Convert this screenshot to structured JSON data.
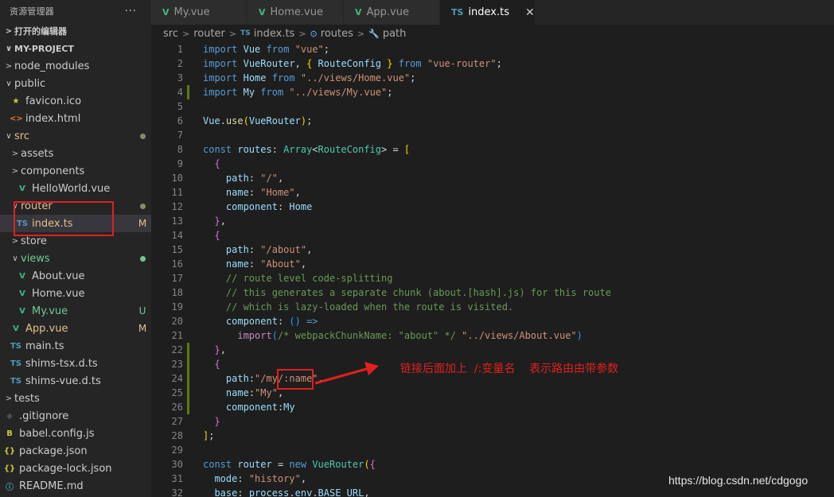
{
  "sidebar": {
    "title": "资源管理器",
    "more": "···",
    "open_editors": "打开的编辑器",
    "project": "MY-PROJECT",
    "items": [
      {
        "label": "node_modules",
        "depth": 1,
        "chevron": ">",
        "icon": "",
        "icon_class": "",
        "badge": "",
        "label_class": "",
        "badge_class": ""
      },
      {
        "label": "public",
        "depth": 1,
        "chevron": "∨",
        "icon": "",
        "icon_class": "",
        "badge": "",
        "label_class": "",
        "badge_class": ""
      },
      {
        "label": "favicon.ico",
        "depth": 2,
        "chevron": "",
        "icon": "★",
        "icon_class": "c-star",
        "badge": "",
        "label_class": "",
        "badge_class": ""
      },
      {
        "label": "index.html",
        "depth": 2,
        "chevron": "",
        "icon": "<>",
        "icon_class": "c-html",
        "badge": "",
        "label_class": "",
        "badge_class": ""
      },
      {
        "label": "src",
        "depth": 1,
        "chevron": "∨",
        "icon": "",
        "icon_class": "",
        "badge": "dot",
        "label_class": "lbl-yellow",
        "badge_class": "lbl-yellow"
      },
      {
        "label": "assets",
        "depth": 2,
        "chevron": ">",
        "icon": "",
        "icon_class": "",
        "badge": "",
        "label_class": "",
        "badge_class": ""
      },
      {
        "label": "components",
        "depth": 2,
        "chevron": ">",
        "icon": "",
        "icon_class": "",
        "badge": "",
        "label_class": "",
        "badge_class": ""
      },
      {
        "label": "HelloWorld.vue",
        "depth": 3,
        "chevron": "",
        "icon": "V",
        "icon_class": "c-vue",
        "badge": "",
        "label_class": "",
        "badge_class": ""
      },
      {
        "label": "router",
        "depth": 2,
        "chevron": "∨",
        "icon": "",
        "icon_class": "",
        "badge": "dot",
        "label_class": "lbl-yellow",
        "badge_class": "lbl-yellow"
      },
      {
        "label": "index.ts",
        "depth": 3,
        "chevron": "",
        "icon": "TS",
        "icon_class": "c-ts",
        "badge": "M",
        "label_class": "lbl-yellow",
        "badge_class": "lbl-yellow",
        "selected": true
      },
      {
        "label": "store",
        "depth": 2,
        "chevron": ">",
        "icon": "",
        "icon_class": "",
        "badge": "",
        "label_class": "",
        "badge_class": ""
      },
      {
        "label": "views",
        "depth": 2,
        "chevron": "∨",
        "icon": "",
        "icon_class": "",
        "badge": "dot",
        "label_class": "lbl-green",
        "badge_class": "lbl-green"
      },
      {
        "label": "About.vue",
        "depth": 3,
        "chevron": "",
        "icon": "V",
        "icon_class": "c-vue",
        "badge": "",
        "label_class": "",
        "badge_class": ""
      },
      {
        "label": "Home.vue",
        "depth": 3,
        "chevron": "",
        "icon": "V",
        "icon_class": "c-vue",
        "badge": "",
        "label_class": "",
        "badge_class": ""
      },
      {
        "label": "My.vue",
        "depth": 3,
        "chevron": "",
        "icon": "V",
        "icon_class": "c-vue",
        "badge": "U",
        "label_class": "lbl-green",
        "badge_class": "lbl-green"
      },
      {
        "label": "App.vue",
        "depth": 2,
        "chevron": "",
        "icon": "V",
        "icon_class": "c-vue",
        "badge": "M",
        "label_class": "lbl-yellow",
        "badge_class": "lbl-yellow"
      },
      {
        "label": "main.ts",
        "depth": 2,
        "chevron": "",
        "icon": "TS",
        "icon_class": "c-ts",
        "badge": "",
        "label_class": "",
        "badge_class": ""
      },
      {
        "label": "shims-tsx.d.ts",
        "depth": 2,
        "chevron": "",
        "icon": "TS",
        "icon_class": "c-ts",
        "badge": "",
        "label_class": "",
        "badge_class": ""
      },
      {
        "label": "shims-vue.d.ts",
        "depth": 2,
        "chevron": "",
        "icon": "TS",
        "icon_class": "c-ts",
        "badge": "",
        "label_class": "",
        "badge_class": ""
      },
      {
        "label": "tests",
        "depth": 1,
        "chevron": ">",
        "icon": "",
        "icon_class": "",
        "badge": "",
        "label_class": "",
        "badge_class": ""
      },
      {
        "label": ".gitignore",
        "depth": 1,
        "chevron": "",
        "icon": "◆",
        "icon_class": "c-git",
        "badge": "",
        "label_class": "",
        "badge_class": ""
      },
      {
        "label": "babel.config.js",
        "depth": 1,
        "chevron": "",
        "icon": "B",
        "icon_class": "c-babel",
        "badge": "",
        "label_class": "",
        "badge_class": ""
      },
      {
        "label": "package.json",
        "depth": 1,
        "chevron": "",
        "icon": "{}",
        "icon_class": "c-json",
        "badge": "",
        "label_class": "",
        "badge_class": ""
      },
      {
        "label": "package-lock.json",
        "depth": 1,
        "chevron": "",
        "icon": "{}",
        "icon_class": "c-json",
        "badge": "",
        "label_class": "",
        "badge_class": ""
      },
      {
        "label": "README.md",
        "depth": 1,
        "chevron": "",
        "icon": "ⓘ",
        "icon_class": "c-md",
        "badge": "",
        "label_class": "",
        "badge_class": ""
      }
    ]
  },
  "tabs": [
    {
      "label": "My.vue",
      "icon": "V",
      "icon_class": "c-vue",
      "active": false
    },
    {
      "label": "Home.vue",
      "icon": "V",
      "icon_class": "c-vue",
      "active": false
    },
    {
      "label": "App.vue",
      "icon": "V",
      "icon_class": "c-vue",
      "active": false
    },
    {
      "label": "index.ts",
      "icon": "TS",
      "icon_class": "c-ts",
      "active": true
    }
  ],
  "tab_close": "✕",
  "breadcrumb": {
    "parts": [
      "src",
      "router",
      "index.ts",
      "routes",
      "path"
    ],
    "icons": [
      "",
      "",
      "TS",
      "⊙",
      "🔧"
    ]
  },
  "editor": {
    "lines": [
      [
        [
          "kw",
          "import"
        ],
        [
          "pl",
          " "
        ],
        [
          "prop",
          "Vue"
        ],
        [
          "pl",
          " "
        ],
        [
          "kw",
          "from"
        ],
        [
          "pl",
          " "
        ],
        [
          "str",
          "\"vue\""
        ],
        [
          "pl",
          ";"
        ]
      ],
      [
        [
          "kw",
          "import"
        ],
        [
          "pl",
          " "
        ],
        [
          "prop",
          "VueRouter"
        ],
        [
          "pl",
          ", "
        ],
        [
          "br1",
          "{"
        ],
        [
          "pl",
          " "
        ],
        [
          "prop",
          "RouteConfig"
        ],
        [
          "pl",
          " "
        ],
        [
          "br1",
          "}"
        ],
        [
          "pl",
          " "
        ],
        [
          "kw",
          "from"
        ],
        [
          "pl",
          " "
        ],
        [
          "str",
          "\"vue-router\""
        ],
        [
          "pl",
          ";"
        ]
      ],
      [
        [
          "kw",
          "import"
        ],
        [
          "pl",
          " "
        ],
        [
          "prop",
          "Home"
        ],
        [
          "pl",
          " "
        ],
        [
          "kw",
          "from"
        ],
        [
          "pl",
          " "
        ],
        [
          "str",
          "\"../views/Home.vue\""
        ],
        [
          "pl",
          ";"
        ]
      ],
      [
        [
          "kw",
          "import"
        ],
        [
          "pl",
          " "
        ],
        [
          "prop",
          "My"
        ],
        [
          "pl",
          " "
        ],
        [
          "kw",
          "from"
        ],
        [
          "pl",
          " "
        ],
        [
          "str",
          "\"../views/My.vue\""
        ],
        [
          "pl",
          ";"
        ]
      ],
      [],
      [
        [
          "prop",
          "Vue"
        ],
        [
          "pl",
          "."
        ],
        [
          "fn",
          "use"
        ],
        [
          "br1",
          "("
        ],
        [
          "prop",
          "VueRouter"
        ],
        [
          "br1",
          ")"
        ],
        [
          "pl",
          ";"
        ]
      ],
      [],
      [
        [
          "kw",
          "const"
        ],
        [
          "pl",
          " "
        ],
        [
          "prop",
          "routes"
        ],
        [
          "pl",
          ": "
        ],
        [
          "ty",
          "Array"
        ],
        [
          "pl",
          "<"
        ],
        [
          "ty",
          "RouteConfig"
        ],
        [
          "pl",
          "> = "
        ],
        [
          "br1",
          "["
        ]
      ],
      [
        [
          "pl",
          "  "
        ],
        [
          "br2",
          "{"
        ]
      ],
      [
        [
          "pl",
          "    "
        ],
        [
          "prop",
          "path"
        ],
        [
          "pl",
          ": "
        ],
        [
          "str",
          "\"/\""
        ],
        [
          "pl",
          ","
        ]
      ],
      [
        [
          "pl",
          "    "
        ],
        [
          "prop",
          "name"
        ],
        [
          "pl",
          ": "
        ],
        [
          "str",
          "\"Home\""
        ],
        [
          "pl",
          ","
        ]
      ],
      [
        [
          "pl",
          "    "
        ],
        [
          "prop",
          "component"
        ],
        [
          "pl",
          ": "
        ],
        [
          "prop",
          "Home"
        ]
      ],
      [
        [
          "pl",
          "  "
        ],
        [
          "br2",
          "}"
        ],
        [
          "pl",
          ","
        ]
      ],
      [
        [
          "pl",
          "  "
        ],
        [
          "br2",
          "{"
        ]
      ],
      [
        [
          "pl",
          "    "
        ],
        [
          "prop",
          "path"
        ],
        [
          "pl",
          ": "
        ],
        [
          "str",
          "\"/about\""
        ],
        [
          "pl",
          ","
        ]
      ],
      [
        [
          "pl",
          "    "
        ],
        [
          "prop",
          "name"
        ],
        [
          "pl",
          ": "
        ],
        [
          "str",
          "\"About\""
        ],
        [
          "pl",
          ","
        ]
      ],
      [
        [
          "pl",
          "    "
        ],
        [
          "cm",
          "// route level code-splitting"
        ]
      ],
      [
        [
          "pl",
          "    "
        ],
        [
          "cm",
          "// this generates a separate chunk (about.[hash].js) for this route"
        ]
      ],
      [
        [
          "pl",
          "    "
        ],
        [
          "cm",
          "// which is lazy-loaded when the route is visited."
        ]
      ],
      [
        [
          "pl",
          "    "
        ],
        [
          "prop",
          "component"
        ],
        [
          "pl",
          ": "
        ],
        [
          "br3",
          "()"
        ],
        [
          "pl",
          " "
        ],
        [
          "kw",
          "=>"
        ]
      ],
      [
        [
          "pl",
          "      "
        ],
        [
          "kw2",
          "import"
        ],
        [
          "br3",
          "("
        ],
        [
          "cm",
          "/* webpackChunkName: \"about\" */"
        ],
        [
          "pl",
          " "
        ],
        [
          "str",
          "\"../views/About.vue\""
        ],
        [
          "br3",
          ")"
        ]
      ],
      [
        [
          "pl",
          "  "
        ],
        [
          "br2",
          "}"
        ],
        [
          "pl",
          ","
        ]
      ],
      [
        [
          "pl",
          "  "
        ],
        [
          "br2",
          "{"
        ]
      ],
      [
        [
          "pl",
          "    "
        ],
        [
          "prop",
          "path"
        ],
        [
          "pl",
          ":"
        ],
        [
          "str",
          "\"/my/:name\""
        ],
        [
          "pl",
          ","
        ]
      ],
      [
        [
          "pl",
          "    "
        ],
        [
          "prop",
          "name"
        ],
        [
          "pl",
          ":"
        ],
        [
          "str",
          "\"My\""
        ],
        [
          "pl",
          ","
        ]
      ],
      [
        [
          "pl",
          "    "
        ],
        [
          "prop",
          "component"
        ],
        [
          "pl",
          ":"
        ],
        [
          "prop",
          "My"
        ]
      ],
      [
        [
          "pl",
          "  "
        ],
        [
          "br2",
          "}"
        ]
      ],
      [
        [
          "br1",
          "]"
        ],
        [
          "pl",
          ";"
        ]
      ],
      [],
      [
        [
          "kw",
          "const"
        ],
        [
          "pl",
          " "
        ],
        [
          "prop",
          "router"
        ],
        [
          "pl",
          " = "
        ],
        [
          "kw",
          "new"
        ],
        [
          "pl",
          " "
        ],
        [
          "ty",
          "VueRouter"
        ],
        [
          "br1",
          "("
        ],
        [
          "br2",
          "{"
        ]
      ],
      [
        [
          "pl",
          "  "
        ],
        [
          "prop",
          "mode"
        ],
        [
          "pl",
          ": "
        ],
        [
          "str",
          "\"history\""
        ],
        [
          "pl",
          ","
        ]
      ],
      [
        [
          "pl",
          "  "
        ],
        [
          "prop",
          "base"
        ],
        [
          "pl",
          ": "
        ],
        [
          "prop",
          "process"
        ],
        [
          "pl",
          "."
        ],
        [
          "prop",
          "env"
        ],
        [
          "pl",
          "."
        ],
        [
          "prop",
          "BASE_URL"
        ],
        [
          "pl",
          ","
        ]
      ]
    ],
    "modified_lines": [
      4,
      22,
      23,
      24,
      25,
      26
    ]
  },
  "annotation": "链接后面加上  /:变量名    表示路由由带参数",
  "watermark": "https://blog.csdn.net/cdgogo"
}
